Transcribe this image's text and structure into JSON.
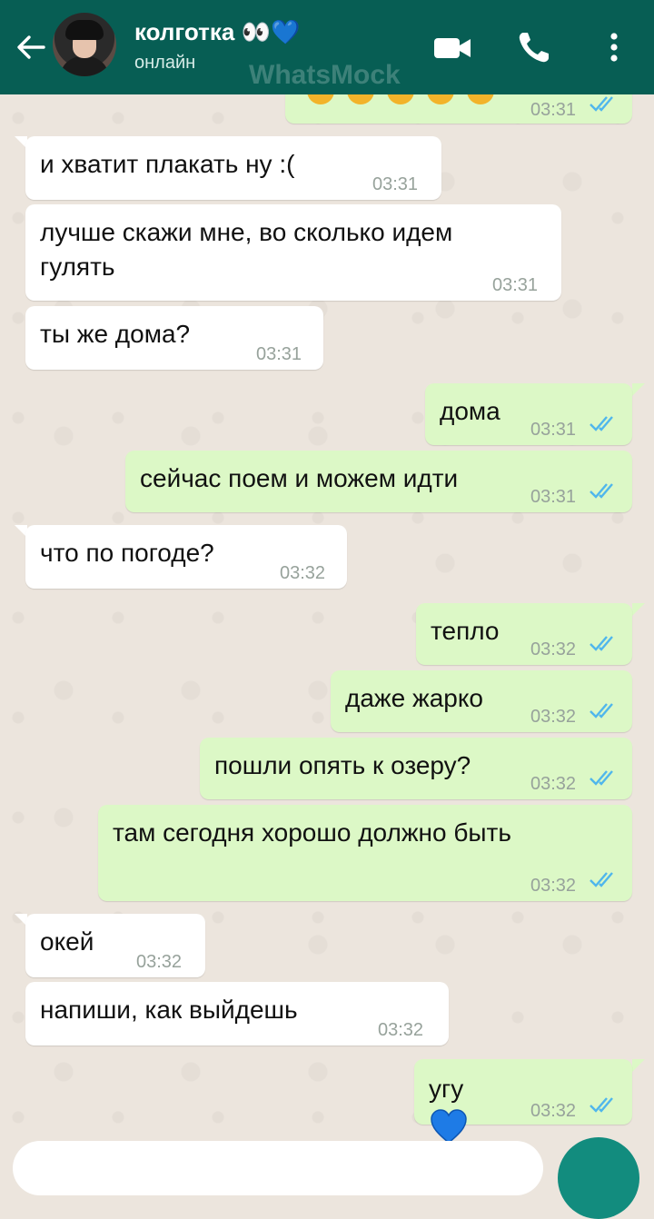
{
  "header": {
    "contact_name": "колготка 👀💙",
    "status": "онлайн",
    "watermark": "WhatsMock"
  },
  "messages": [
    {
      "id": "m0",
      "dir": "out",
      "text": "",
      "time": "03:31",
      "ticks": "read",
      "partial": true
    },
    {
      "id": "m1",
      "dir": "in",
      "text": "и хватит плакать ну :(",
      "time": "03:31"
    },
    {
      "id": "m2",
      "dir": "in",
      "text": "лучше скажи мне, во сколько идем\nгулять",
      "time": "03:31"
    },
    {
      "id": "m3",
      "dir": "in",
      "text": "ты же дома?",
      "time": "03:31"
    },
    {
      "id": "m4",
      "dir": "out",
      "text": "дома",
      "time": "03:31",
      "ticks": "read"
    },
    {
      "id": "m5",
      "dir": "out",
      "text": "сейчас поем и можем идти",
      "time": "03:31",
      "ticks": "read"
    },
    {
      "id": "m6",
      "dir": "in",
      "text": "что по погоде?",
      "time": "03:32"
    },
    {
      "id": "m7",
      "dir": "out",
      "text": "тепло",
      "time": "03:32",
      "ticks": "read"
    },
    {
      "id": "m8",
      "dir": "out",
      "text": "даже жарко",
      "time": "03:32",
      "ticks": "read"
    },
    {
      "id": "m9",
      "dir": "out",
      "text": "пошли опять к озеру?",
      "time": "03:32",
      "ticks": "read"
    },
    {
      "id": "m10",
      "dir": "out",
      "text": "там сегодня хорошо должно быть",
      "time": "03:32",
      "ticks": "read"
    },
    {
      "id": "m11",
      "dir": "in",
      "text": "окей",
      "time": "03:32"
    },
    {
      "id": "m12",
      "dir": "in",
      "text": "напиши, как выйдешь",
      "time": "03:32"
    },
    {
      "id": "m13",
      "dir": "out",
      "text": "угу",
      "emoji": "blue-heart",
      "time": "03:32",
      "ticks": "read"
    }
  ],
  "colors": {
    "header": "#075e54",
    "outgoing_bubble": "#dcf8c6",
    "incoming_bubble": "#ffffff",
    "read_ticks": "#4fb6ec",
    "background": "#ece5dd"
  },
  "icons": [
    "back-arrow-icon",
    "video-call-icon",
    "phone-icon",
    "more-vert-icon",
    "double-check-icon",
    "blue-heart-emoji"
  ]
}
